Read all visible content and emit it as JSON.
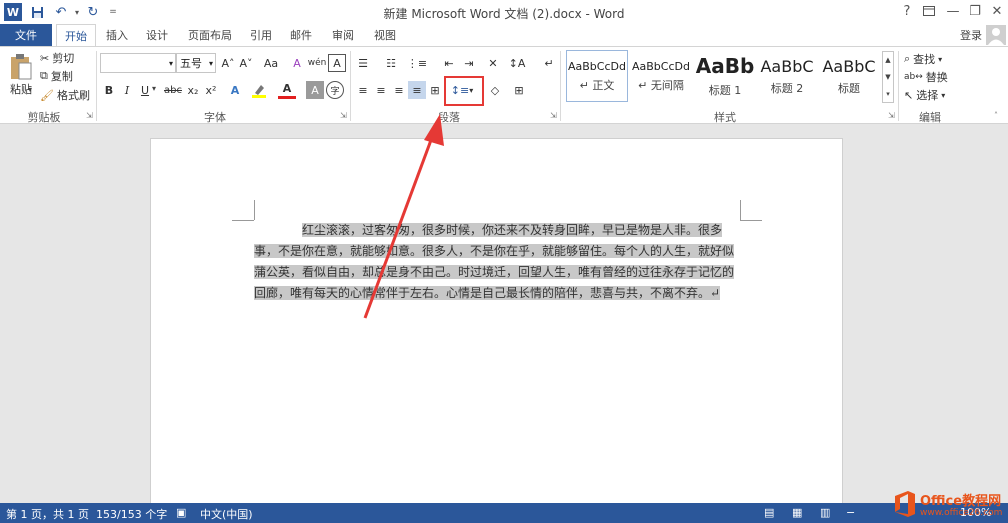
{
  "window": {
    "title": "新建 Microsoft Word 文档 (2).docx - Word",
    "help": "?",
    "minimize": "—",
    "restore": "❐",
    "close": "✕"
  },
  "qat": {
    "word_icon": "W",
    "save_icon": "save-icon",
    "undo": "↶",
    "redo": "↻",
    "more": "="
  },
  "tabs": [
    {
      "label": "文件"
    },
    {
      "label": "开始"
    },
    {
      "label": "插入"
    },
    {
      "label": "设计"
    },
    {
      "label": "页面布局"
    },
    {
      "label": "引用"
    },
    {
      "label": "邮件"
    },
    {
      "label": "审阅"
    },
    {
      "label": "视图"
    }
  ],
  "account": {
    "login": "登录"
  },
  "clipboard": {
    "paste": "粘贴",
    "cut": "剪切",
    "copy": "复制",
    "format_painter": "格式刷",
    "group": "剪贴板"
  },
  "font": {
    "name_value": "",
    "size_value": "五号",
    "grow": "A˄",
    "shrink": "A˅",
    "case": "Aa",
    "bold": "B",
    "italic": "I",
    "underline": "U",
    "strike": "abc",
    "sub": "x₂",
    "sup": "x²",
    "group": "字体"
  },
  "paragraph": {
    "group": "段落"
  },
  "styles": {
    "group": "样式",
    "items": [
      {
        "sample": "AaBbCcDd",
        "name": "↵ 正文"
      },
      {
        "sample": "AaBbCcDd",
        "name": "↵ 无间隔"
      },
      {
        "sample": "AaBb",
        "name": "标题 1"
      },
      {
        "sample": "AaBbC",
        "name": "标题 2"
      },
      {
        "sample": "AaBbC",
        "name": "标题"
      }
    ]
  },
  "editing": {
    "find": "查找",
    "replace": "替换",
    "select": "选择",
    "group": "编辑"
  },
  "document": {
    "paragraph": "红尘滚滚，过客匆匆，很多时候，你还来不及转身回眸，早已是物是人非。很多事，不是你在意，就能够如意。很多人，不是你在乎，就能够留住。每个人的人生，就好似蒲公英，看似自由，却总是身不由己。时过境迁，回望人生，唯有曾经的过往永存于记忆的回廊，唯有每天的心情常伴于左右。心情是自己最长情的陪伴，悲喜与共，不离不弃。↵"
  },
  "status": {
    "page": "第 1 页，共 1 页",
    "words": "153/153 个字",
    "lang": "中文(中国)",
    "zoom": "100%"
  },
  "watermark": {
    "brand": "Office教程网",
    "url": "www.office26.com"
  },
  "colors": {
    "accent": "#2b579a",
    "annotation": "#e53935"
  }
}
